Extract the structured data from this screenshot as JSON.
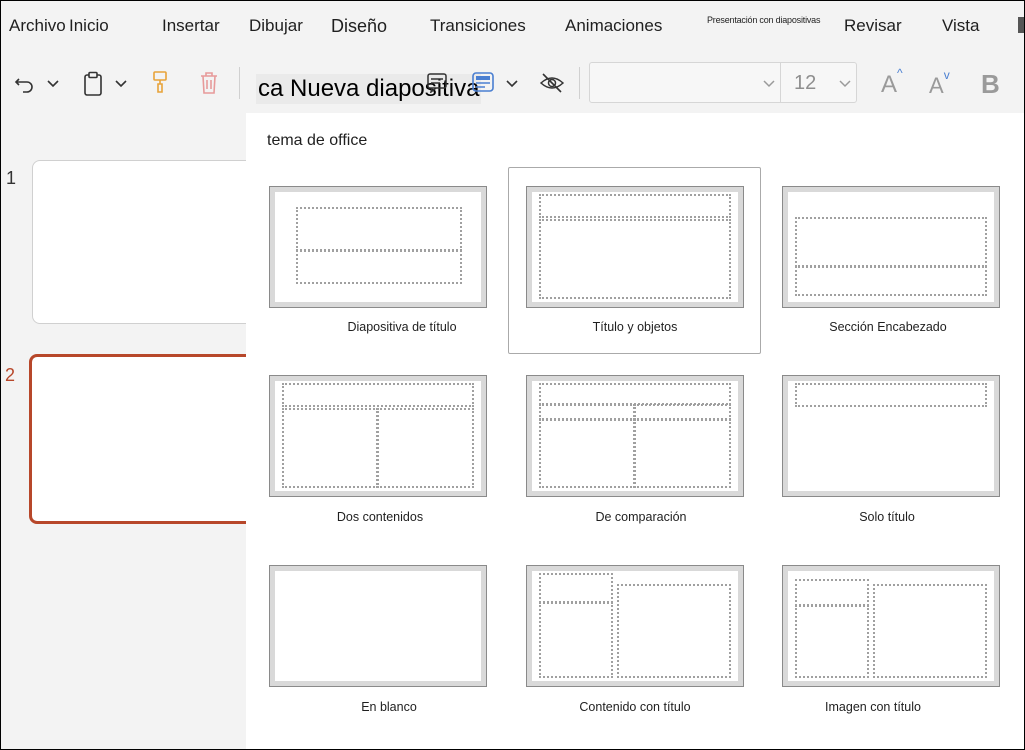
{
  "menu": {
    "archivo": "Archivo",
    "inicio": "Inicio",
    "insertar": "Insertar",
    "dibujar": "Dibujar",
    "diseno": "Diseño",
    "transiciones": "Transiciones",
    "animaciones": "Animaciones",
    "presentacion": "Presentación con diapositivas",
    "revisar": "Revisar",
    "vista": "Vista"
  },
  "toolbar": {
    "new_slide_label": "ca Nueva diapositiva",
    "font_size": "12",
    "bold_label": "B",
    "grow_font": "A",
    "shrink_font": "A"
  },
  "icons": {
    "undo": "undo-icon",
    "paste": "clipboard-icon",
    "format_painter": "paintbrush-icon",
    "delete": "trash-icon",
    "layout": "layout-icon",
    "hide": "hide-slide-icon"
  },
  "thumbnails": [
    {
      "number": "1"
    },
    {
      "number": "2"
    }
  ],
  "layouts_panel": {
    "theme_title": "tema de office",
    "layouts": [
      {
        "name": "Diapositiva de título"
      },
      {
        "name": "Título y objetos"
      },
      {
        "name": "Sección  Encabezado"
      },
      {
        "name": "Dos contenidos"
      },
      {
        "name": "De comparación"
      },
      {
        "name": "Solo título"
      },
      {
        "name": "En blanco"
      },
      {
        "name": "Contenido con título"
      },
      {
        "name": "Imagen con título"
      }
    ]
  },
  "colors": {
    "accent": "#b7472a",
    "selected_layout_border": "#aaaaaa",
    "layout_icon_blue": "#4a7fd1"
  }
}
